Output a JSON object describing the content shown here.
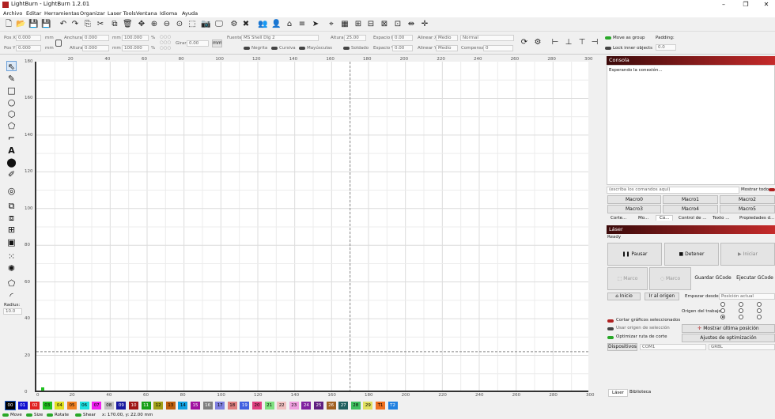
{
  "app": {
    "title": "LightBurn - LightBurn 1.2.01"
  },
  "menu": [
    "Archivo",
    "Editar",
    "Herramientas",
    "Organizar",
    "Laser Tools",
    "Ventana",
    "Idioma",
    "Ayuda"
  ],
  "toolbar": {
    "posx_label": "Pos X",
    "posx_value": "0.000",
    "posy_label": "Pos Y",
    "posy_value": "0.000",
    "unit": "mm",
    "width_label": "Anchura",
    "width_value": "0.000",
    "height_label": "Altura",
    "height_value": "0.000",
    "scalex_value": "100.000",
    "scaley_value": "100.000",
    "percent": "%",
    "rotate_label": "Girar",
    "rotate_value": "0.00",
    "mm_button": "mm",
    "font_label": "Fuente",
    "font_value": "MS Shell Dlg 2",
    "fheight_label": "Altura",
    "fheight_value": "25.00",
    "hspace_label": "Espacio H",
    "hspace_value": "0.00",
    "vspace_label": "Espacio V",
    "vspace_value": "0.00",
    "alignx_label": "Alinear X",
    "alignx_value": "Medio",
    "aligny_label": "Alinear Y",
    "aligny_value": "Medio",
    "normal_value": "Normal",
    "offset_label": "Compensar",
    "offset_value": "0",
    "bold": "Negrita",
    "italic": "Cursiva",
    "upper": "Mayúsculas",
    "welded": "Soldado",
    "move_group": "Move as group",
    "lock_inner": "Lock inner objects",
    "padding_label": "Padding:",
    "padding_value": "0.0"
  },
  "left": {
    "radius_label": "Radius:",
    "radius_value": "10.0"
  },
  "ruler": {
    "top": [
      "20",
      "40",
      "60",
      "80",
      "100",
      "120",
      "140",
      "160",
      "180",
      "200",
      "220",
      "240",
      "260",
      "280",
      "300"
    ],
    "left": [
      "180",
      "160",
      "140",
      "120",
      "100",
      "80",
      "60",
      "40",
      "20",
      "0"
    ],
    "bottom": [
      "0",
      "20",
      "40",
      "60",
      "80",
      "100",
      "120",
      "140",
      "160",
      "180",
      "200",
      "220",
      "240",
      "260",
      "280",
      "300"
    ]
  },
  "palette": [
    {
      "l": "00",
      "c": "#000000",
      "t": "#ffffff"
    },
    {
      "l": "01",
      "c": "#1010d0",
      "t": "#ffffff"
    },
    {
      "l": "02",
      "c": "#e02020",
      "t": "#ffffff"
    },
    {
      "l": "03",
      "c": "#20c020",
      "t": "#000000"
    },
    {
      "l": "04",
      "c": "#e0e020",
      "t": "#000000"
    },
    {
      "l": "05",
      "c": "#f08020",
      "t": "#000000"
    },
    {
      "l": "06",
      "c": "#20e0e0",
      "t": "#000000"
    },
    {
      "l": "07",
      "c": "#f020f0",
      "t": "#000000"
    },
    {
      "l": "08",
      "c": "#c0c0c0",
      "t": "#000000"
    },
    {
      "l": "09",
      "c": "#1818a0",
      "t": "#ffffff"
    },
    {
      "l": "10",
      "c": "#a01818",
      "t": "#ffffff"
    },
    {
      "l": "11",
      "c": "#18a018",
      "t": "#ffffff"
    },
    {
      "l": "12",
      "c": "#a0a018",
      "t": "#000000"
    },
    {
      "l": "13",
      "c": "#c06010",
      "t": "#000000"
    },
    {
      "l": "14",
      "c": "#10a0e0",
      "t": "#000000"
    },
    {
      "l": "15",
      "c": "#a010a0",
      "t": "#ffffff"
    },
    {
      "l": "16",
      "c": "#808080",
      "t": "#ffffff"
    },
    {
      "l": "17",
      "c": "#8080e0",
      "t": "#000000"
    },
    {
      "l": "18",
      "c": "#e08080",
      "t": "#000000"
    },
    {
      "l": "19",
      "c": "#4060e0",
      "t": "#ffffff"
    },
    {
      "l": "20",
      "c": "#e04080",
      "t": "#000000"
    },
    {
      "l": "21",
      "c": "#80e080",
      "t": "#000000"
    },
    {
      "l": "22",
      "c": "#f0c0c0",
      "t": "#000000"
    },
    {
      "l": "23",
      "c": "#f0a0e0",
      "t": "#000000"
    },
    {
      "l": "24",
      "c": "#8020a0",
      "t": "#ffffff"
    },
    {
      "l": "25",
      "c": "#602080",
      "t": "#ffffff"
    },
    {
      "l": "26",
      "c": "#a06020",
      "t": "#ffffff"
    },
    {
      "l": "27",
      "c": "#206060",
      "t": "#ffffff"
    },
    {
      "l": "28",
      "c": "#40c060",
      "t": "#000000"
    },
    {
      "l": "29",
      "c": "#e0e060",
      "t": "#000000"
    },
    {
      "l": "T1",
      "c": "#f07020",
      "t": "#000000"
    },
    {
      "l": "T2",
      "c": "#2080e0",
      "t": "#ffffff"
    }
  ],
  "status": {
    "move": "Move",
    "size": "Size",
    "rotate": "Rotate",
    "shear": "Shear",
    "coords": "x: 170.00, y: 22.00 mm"
  },
  "console": {
    "title": "Consola",
    "text": "Esperando la conexión...",
    "placeholder": "(escriba los comandos aquí)",
    "show_all": "Mostrar todo",
    "macros": [
      "Macro0",
      "Macro1",
      "Macro2",
      "Macro3",
      "Macro4",
      "Macro5"
    ],
    "tabs": [
      "Corte...",
      "Mo...",
      "Co...",
      "Control de ...",
      "Texto ...",
      "Propiedades d..."
    ]
  },
  "laser": {
    "title": "Láser",
    "status": "Ready",
    "pause": "Pausar",
    "stop": "Detener",
    "start": "Iniciar",
    "frame1": "Marco",
    "frame2": "Marco",
    "save_gcode": "Guardar GCode",
    "run_gcode": "Ejecutar GCode",
    "home": "Inicio",
    "goto_origin": "Ir al origen",
    "start_from_label": "Empezar desde:",
    "start_from_value": "Posición actual",
    "job_origin_label": "Origen del trabajo",
    "cut_selected": "Cortar gráficos seleccionados",
    "use_selection_origin": "Usar origen de selección",
    "show_last_pos": "Mostrar última posición",
    "optimize": "Optimizar ruta de corte",
    "opt_settings": "Ajustes de optimización",
    "devices": "Dispositivos",
    "port": "COM1",
    "firmware": "GRBL",
    "tabs": [
      "Láser",
      "Biblioteca"
    ]
  }
}
